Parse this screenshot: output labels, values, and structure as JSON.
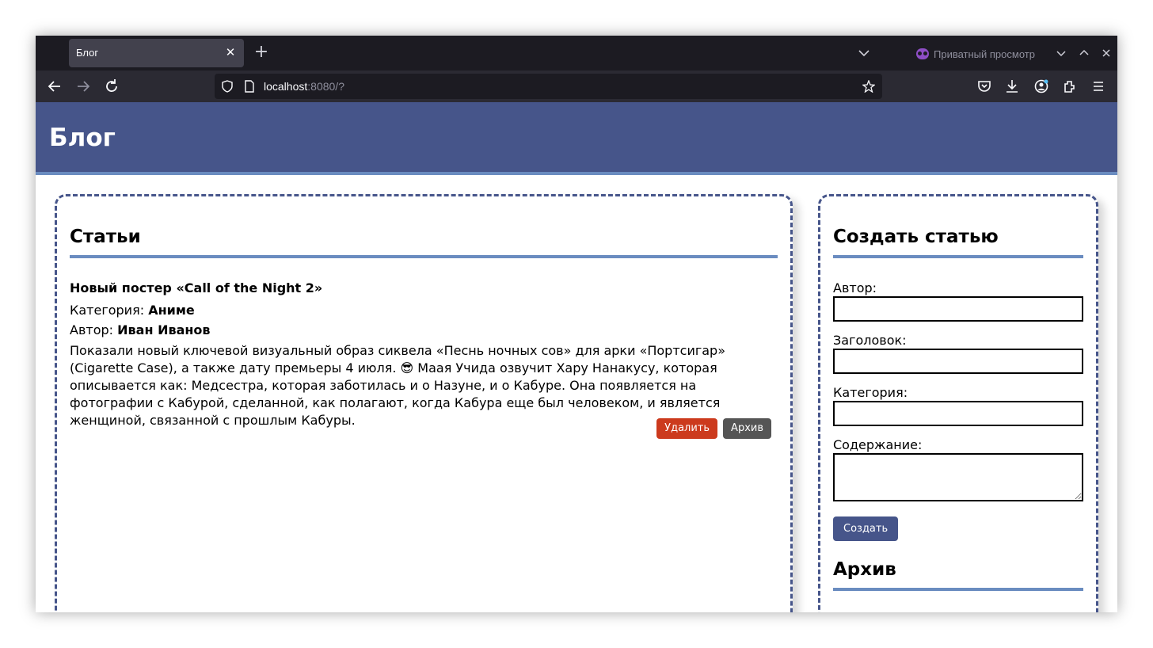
{
  "browser": {
    "tab_title": "Блог",
    "tab_close": "✕",
    "new_tab": "+",
    "private_label": "Приватный просмотр",
    "url_host": "localhost",
    "url_rest": ":8080/?",
    "icons": {
      "back": "arrow-left-icon",
      "forward": "arrow-right-icon",
      "reload": "reload-icon",
      "shield": "shield-icon",
      "page": "page-icon",
      "star": "star-icon",
      "pocket": "pocket-icon",
      "download": "download-icon",
      "account": "account-icon",
      "extensions": "extensions-icon",
      "menu": "menu-icon"
    }
  },
  "site": {
    "title": "Блог"
  },
  "articles": {
    "heading": "Статьи",
    "items": [
      {
        "title": "Новый постер «Call of the Night 2»",
        "category_label": "Категория: ",
        "category": "Аниме",
        "author_label": "Автор: ",
        "author": "Иван Иванов",
        "body": "Показали новый ключевой визуальный образ сиквела «Песнь ночных сов» для арки «Портсигар» (Cigarette Case), а также дату премьеры 4 июля. 😎 Маая Учида озвучит Хару Нанакусу, которая описывается как: Медсестра, которая заботилась и о Назуне, и о Кабуре. Она появляется на фотографии с Кабурой, сделанной, как полагают, когда Кабура еще был человеком, и является женщиной, связанной с прошлым Кабуры.",
        "delete_label": "Удалить",
        "archive_label": "Архив"
      }
    ]
  },
  "create_form": {
    "heading": "Создать статью",
    "author_label": "Автор:",
    "title_label": "Заголовок:",
    "category_label": "Категория:",
    "content_label": "Содержание:",
    "author_value": "",
    "title_value": "",
    "category_value": "",
    "content_value": "",
    "submit_label": "Создать"
  },
  "archive": {
    "heading": "Архив"
  },
  "colors": {
    "header_bg": "#46558a",
    "accent_line": "#6a8cc0",
    "delete_btn": "#cc3a1d",
    "archive_btn": "#555555"
  }
}
